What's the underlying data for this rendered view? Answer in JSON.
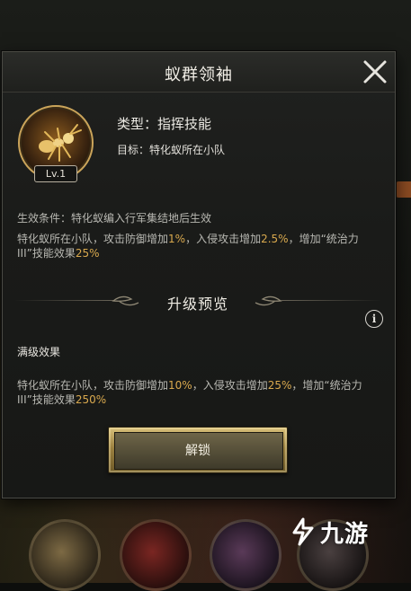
{
  "dialog": {
    "title": "蚁群领袖"
  },
  "skill": {
    "level": "Lv.1",
    "type": "类型：指挥技能",
    "target": "目标：特化蚁所在小队",
    "condition": "生效条件：特化蚁编入行军集结地后生效",
    "effect_current": {
      "p1": "特化蚁所在小队，攻击防御增加",
      "v1": "1%",
      "p2": "，入侵攻击增加",
      "v2": "2.5%",
      "p3": "，增加“统治力III”技能效果",
      "v3": "25%"
    }
  },
  "upgrade": {
    "title": "升级预览",
    "max_label": "满级效果",
    "effect_max": {
      "p1": "特化蚁所在小队，攻击防御增加",
      "v1": "10%",
      "p2": "，入侵攻击增加",
      "v2": "25%",
      "p3": "，增加“统治力III”技能效果",
      "v3": "250%"
    }
  },
  "actions": {
    "unlock_label": "解锁"
  },
  "watermark": {
    "text": "九游"
  },
  "colors": {
    "highlight": "#d9a94e",
    "gold_button": "#9c8140"
  }
}
